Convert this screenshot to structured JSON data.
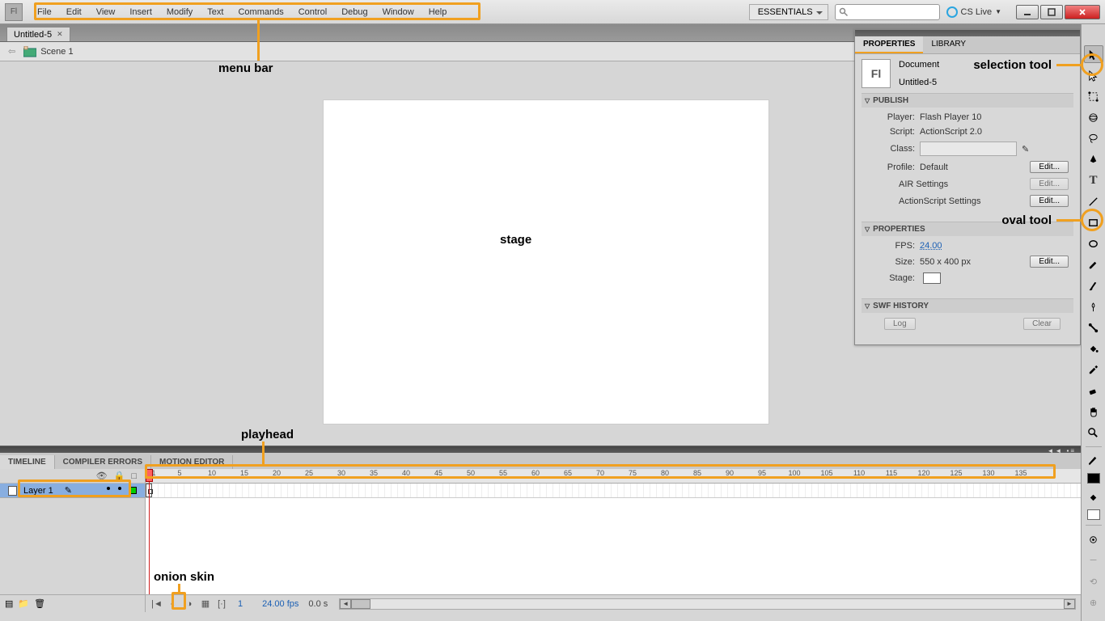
{
  "app": {
    "icon_label": "Fl"
  },
  "menubar": {
    "items": [
      "File",
      "Edit",
      "View",
      "Insert",
      "Modify",
      "Text",
      "Commands",
      "Control",
      "Debug",
      "Window",
      "Help"
    ],
    "workspace": "ESSENTIALS",
    "cs_live": "CS Live"
  },
  "annotations": {
    "menu_bar": "menu bar",
    "stage": "stage",
    "playhead": "playhead",
    "onion_skin": "onion skin",
    "selection_tool": "selection tool",
    "oval_tool": "oval tool"
  },
  "doc_tab": {
    "title": "Untitled-5"
  },
  "scene": {
    "name": "Scene 1"
  },
  "properties": {
    "tabs": [
      "PROPERTIES",
      "LIBRARY"
    ],
    "doc_label": "Document",
    "doc_name": "Untitled-5",
    "fl": "Fl",
    "publish": {
      "title": "PUBLISH",
      "player_lbl": "Player:",
      "player_val": "Flash Player 10",
      "script_lbl": "Script:",
      "script_val": "ActionScript 2.0",
      "class_lbl": "Class:",
      "profile_lbl": "Profile:",
      "profile_val": "Default",
      "edit": "Edit...",
      "air": "AIR Settings",
      "as_settings": "ActionScript Settings"
    },
    "props": {
      "title": "PROPERTIES",
      "fps_lbl": "FPS:",
      "fps_val": "24.00",
      "size_lbl": "Size:",
      "size_val": "550 x 400 px",
      "stage_lbl": "Stage:",
      "edit": "Edit..."
    },
    "swf": {
      "title": "SWF HISTORY",
      "log": "Log",
      "clear": "Clear"
    }
  },
  "timeline": {
    "tabs": [
      "TIMELINE",
      "COMPILER ERRORS",
      "MOTION EDITOR"
    ],
    "layer": "Layer 1",
    "ruler_marks": [
      1,
      5,
      10,
      15,
      20,
      25,
      30,
      35,
      40,
      45,
      50,
      55,
      60,
      65,
      70,
      75,
      80,
      85,
      90,
      95,
      100,
      105,
      110,
      115,
      120,
      125,
      130,
      135
    ],
    "frame": "1",
    "fps": "24.00 fps",
    "time": "0.0 s"
  }
}
